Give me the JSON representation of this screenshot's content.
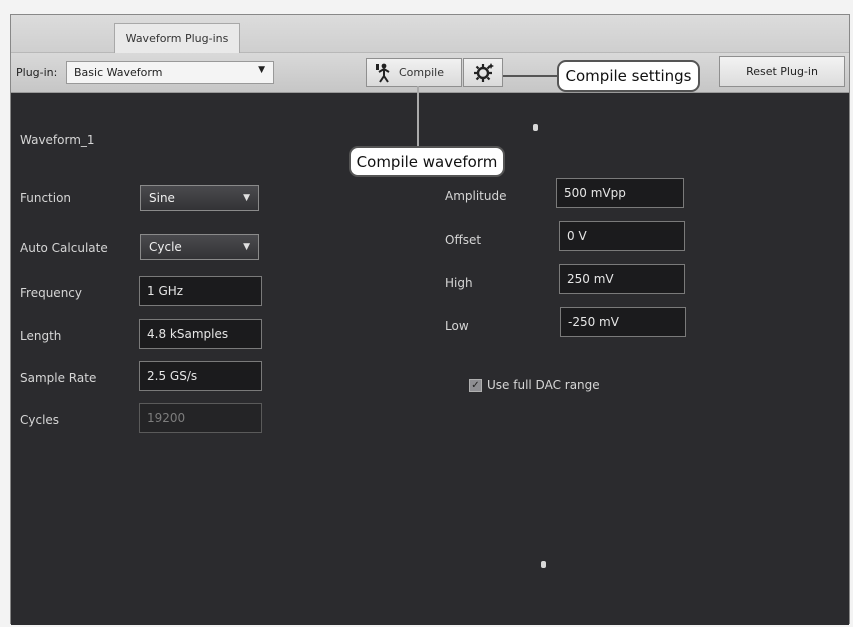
{
  "tabs": [
    {
      "label": "Waveform Plug-ins",
      "active": true
    }
  ],
  "toolbar": {
    "plugin_label": "Plug-in:",
    "plugin_value": "Basic Waveform",
    "compile_label": "Compile",
    "settings_icon": "gear-sparkle-icon",
    "reset_label": "Reset Plug-in"
  },
  "callouts": {
    "compile_settings": "Compile settings",
    "compile_waveform": "Compile waveform"
  },
  "waveform": {
    "name": "Waveform_1",
    "function": {
      "label": "Function",
      "value": "Sine"
    },
    "auto_calculate": {
      "label": "Auto Calculate",
      "value": "Cycle"
    },
    "frequency": {
      "label": "Frequency",
      "value": "1 GHz"
    },
    "length": {
      "label": "Length",
      "value": "4.8 kSamples"
    },
    "sample_rate": {
      "label": "Sample Rate",
      "value": "2.5 GS/s"
    },
    "cycles": {
      "label": "Cycles",
      "value": "19200"
    },
    "amplitude": {
      "label": "Amplitude",
      "value": "500 mVpp"
    },
    "offset": {
      "label": "Offset",
      "value": "0 V"
    },
    "high": {
      "label": "High",
      "value": "250 mV"
    },
    "low": {
      "label": "Low",
      "value": "-250 mV"
    },
    "use_full_dac": {
      "label": "Use full DAC range",
      "checked": true
    }
  },
  "colors": {
    "panel_bg": "#2b2b2e",
    "toolbar_bg": "#d0d0d0",
    "callout_border": "#555555"
  }
}
